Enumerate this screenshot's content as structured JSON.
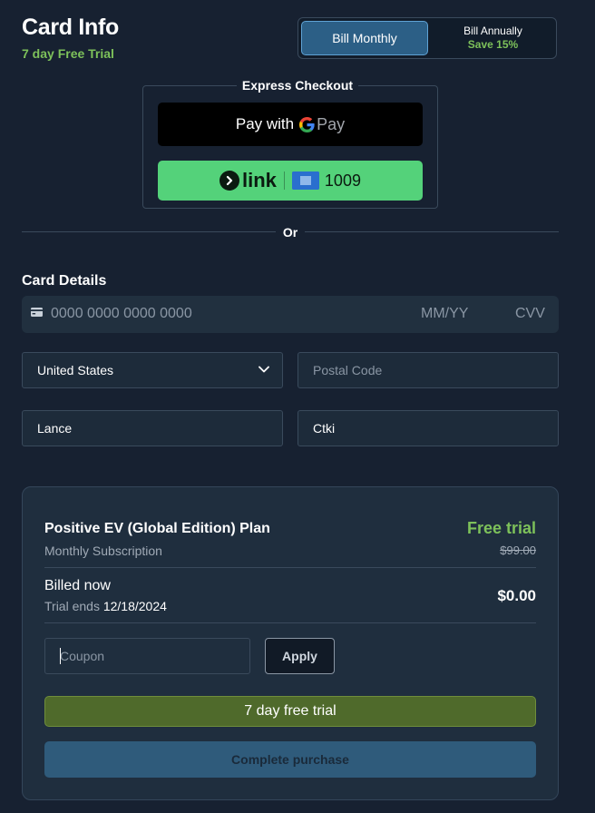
{
  "header": {
    "title": "Card Info",
    "trial_tag": "7 day Free Trial"
  },
  "billing_toggle": {
    "monthly_label": "Bill Monthly",
    "annual_label": "Bill Annually",
    "annual_save": "Save 15%",
    "selected": "monthly"
  },
  "express_checkout": {
    "legend": "Express Checkout",
    "gpay_prefix": "Pay with",
    "gpay_brand_g": "G",
    "gpay_brand_pay": "Pay",
    "link_brand": "link",
    "link_card_last4": "1009"
  },
  "divider_or": "Or",
  "card_details": {
    "label": "Card Details",
    "number_placeholder": "0000 0000 0000 0000",
    "expiry_placeholder": "MM/YY",
    "cvv_placeholder": "CVV"
  },
  "address": {
    "country_value": "United States",
    "postal_placeholder": "Postal Code",
    "first_name_value": "Lance",
    "last_name_value": "Ctki"
  },
  "summary": {
    "plan_name": "Positive EV (Global Edition) Plan",
    "plan_subtitle": "Monthly Subscription",
    "free_trial_label": "Free trial",
    "original_price": "$99.00",
    "billed_now_label": "Billed now",
    "trial_ends_label": "Trial ends",
    "trial_ends_date": "12/18/2024",
    "billed_now_amount": "$0.00",
    "coupon_placeholder": "Coupon",
    "apply_label": "Apply",
    "trial_banner": "7 day free trial",
    "complete_label": "Complete purchase"
  },
  "colors": {
    "background": "#172131",
    "accent_green": "#7dc15a",
    "link_green": "#54d27a",
    "toggle_selected": "#2c5f86",
    "trial_banner": "#4f6a2b",
    "complete_button": "#2f5b7b"
  }
}
